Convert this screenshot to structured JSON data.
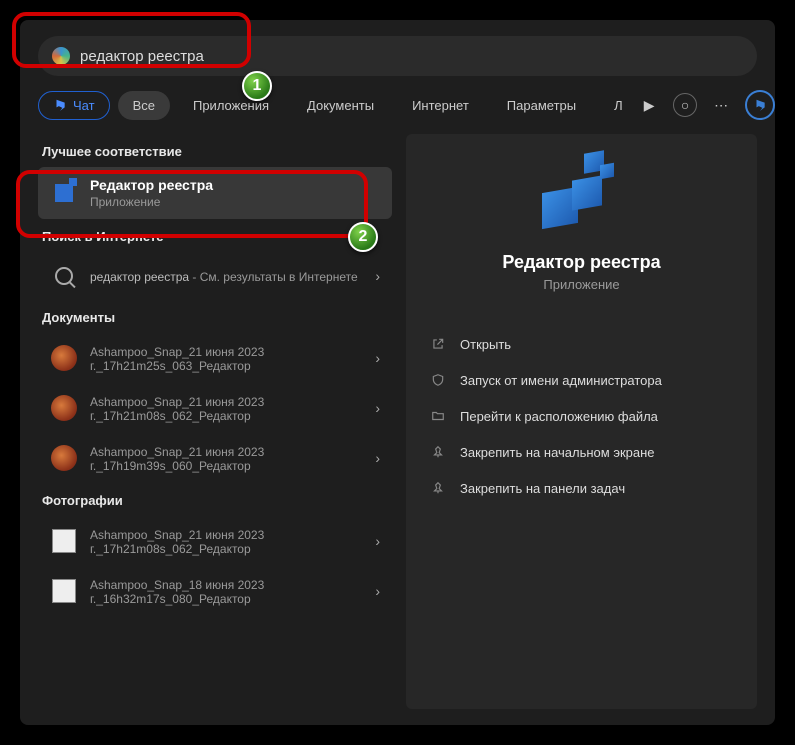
{
  "search": {
    "query": "редактор реестра"
  },
  "tabs": {
    "chat": "Чат",
    "all": "Все",
    "apps": "Приложения",
    "docs": "Документы",
    "internet": "Интернет",
    "settings": "Параметры",
    "more_initial": "Л"
  },
  "sections": {
    "best_match": "Лучшее соответствие",
    "web_search": "Поиск в Интернете",
    "documents": "Документы",
    "photos": "Фотографии"
  },
  "best": {
    "title": "Редактор реестра",
    "subtitle": "Приложение"
  },
  "web": {
    "query": "редактор реестра",
    "suffix": " - См. результаты в Интернете"
  },
  "documents": [
    {
      "title": "Ashampoo_Snap_21 июня 2023 г._17h21m25s_063_Редактор"
    },
    {
      "title": "Ashampoo_Snap_21 июня 2023 г._17h21m08s_062_Редактор"
    },
    {
      "title": "Ashampoo_Snap_21 июня 2023 г._17h19m39s_060_Редактор"
    }
  ],
  "photos": [
    {
      "title": "Ashampoo_Snap_21 июня 2023 г._17h21m08s_062_Редактор"
    },
    {
      "title": "Ashampoo_Snap_18 июня 2023 г._16h32m17s_080_Редактор"
    }
  ],
  "preview": {
    "title": "Редактор реестра",
    "subtitle": "Приложение"
  },
  "actions": {
    "open": "Открыть",
    "run_admin": "Запуск от имени администратора",
    "open_location": "Перейти к расположению файла",
    "pin_start": "Закрепить на начальном экране",
    "pin_taskbar": "Закрепить на панели задач"
  },
  "callouts": {
    "one": "1",
    "two": "2"
  }
}
